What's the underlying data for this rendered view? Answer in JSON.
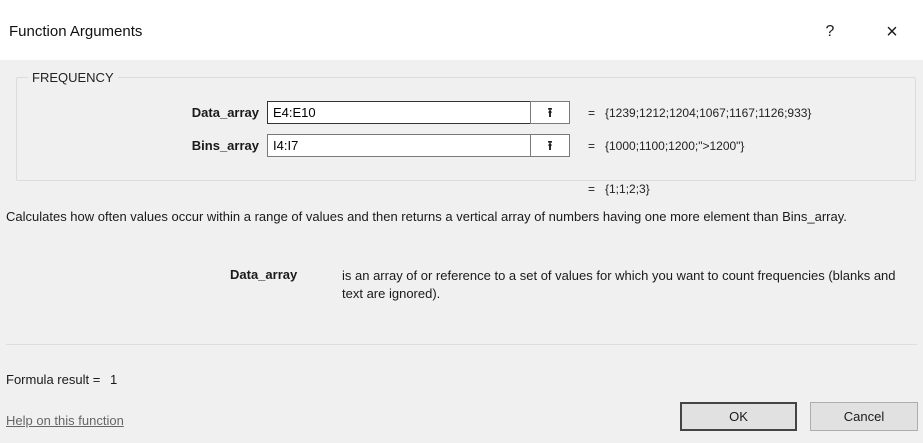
{
  "window": {
    "title": "Function Arguments",
    "help_glyph": "?",
    "close_glyph": "×"
  },
  "function_name": "FREQUENCY",
  "arguments": [
    {
      "label": "Data_array",
      "value": "E4:E10",
      "ref_icon": "⭱",
      "equals": "=",
      "evaluated": "{1239;1212;1204;1067;1167;1126;933}"
    },
    {
      "label": "Bins_array",
      "value": "I4:I7",
      "ref_icon": "⭱",
      "equals": "=",
      "evaluated": "{1000;1100;1200;\">1200\"}"
    }
  ],
  "result_preview": {
    "equals": "=",
    "value": "{1;1;2;3}"
  },
  "description": "Calculates how often values occur within a range of values and then returns a vertical array of numbers having one more element than Bins_array.",
  "param_help": {
    "name": "Data_array",
    "text": "is an array of or reference to a set of values for which you want to count frequencies (blanks and text are ignored)."
  },
  "formula_result": {
    "label": "Formula result =",
    "value": "1"
  },
  "help_link": "Help on this function",
  "buttons": {
    "ok": "OK",
    "cancel": "Cancel"
  }
}
